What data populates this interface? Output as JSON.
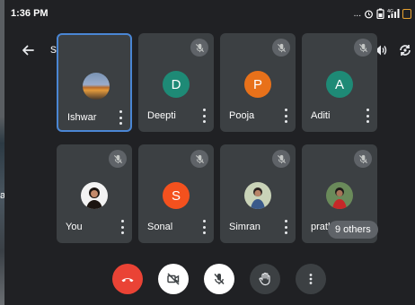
{
  "status_bar": {
    "time": "1:36 PM",
    "right_icons": [
      "more-dots-icon",
      "alarm-icon",
      "battery-saver-icon",
      "signal-4g-icon",
      "battery-icon"
    ],
    "dots": "..."
  },
  "header": {
    "meeting_code": "stv-fknn-udc",
    "back_icon": "arrow-left-icon",
    "speaker_icon": "speaker-icon",
    "switch_camera_icon": "switch-camera-icon"
  },
  "participants": [
    {
      "name": "Ishwar",
      "avatar_type": "photo",
      "active": true,
      "muted": false
    },
    {
      "name": "Deepti",
      "initial": "D",
      "color": "#1e8a76",
      "muted": true
    },
    {
      "name": "Pooja",
      "initial": "P",
      "color": "#e8711a",
      "muted": true
    },
    {
      "name": "Aditi",
      "initial": "A",
      "color": "#1e8a76",
      "muted": true
    },
    {
      "name": "You",
      "avatar_type": "photo",
      "muted": true
    },
    {
      "name": "Sonal",
      "initial": "S",
      "color": "#f4511e",
      "muted": true
    },
    {
      "name": "Simran",
      "avatar_type": "photo",
      "muted": true
    },
    {
      "name": "prath",
      "avatar_type": "photo",
      "muted": true
    }
  ],
  "others_badge": "9 others",
  "edge_text": "a",
  "controls": [
    {
      "name": "end-call",
      "icon": "phone-hangup-icon",
      "color": "#ea4335"
    },
    {
      "name": "camera-off",
      "icon": "video-off-icon",
      "color": "#ffffff"
    },
    {
      "name": "mic-off",
      "icon": "mic-off-icon",
      "color": "#ffffff"
    },
    {
      "name": "raise-hand",
      "icon": "hand-icon",
      "color": "#3c4043"
    },
    {
      "name": "more-options",
      "icon": "more-vert-icon",
      "color": "#3c4043"
    }
  ]
}
